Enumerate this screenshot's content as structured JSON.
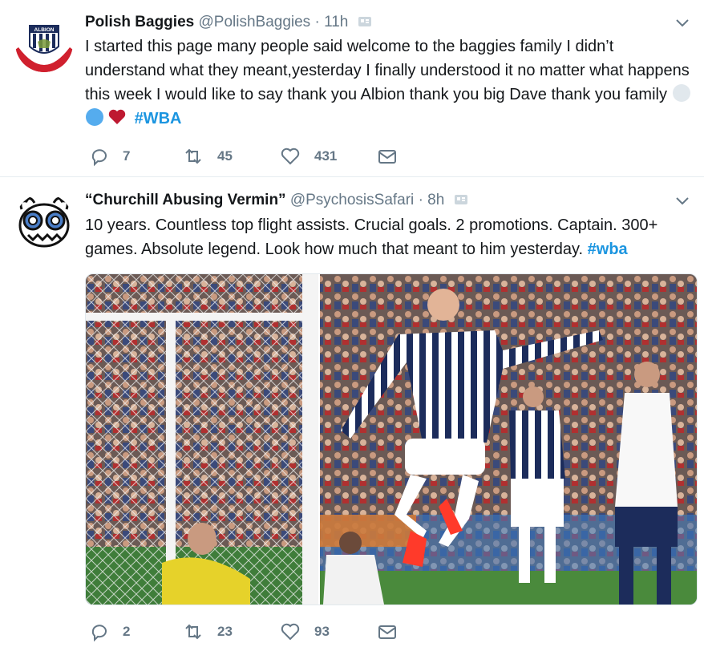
{
  "tweets": [
    {
      "display_name": "Polish Baggies",
      "handle": "@PolishBaggies",
      "separator": "·",
      "time": "11h",
      "avatar_text": "ALBION",
      "text": "I started this page many people said welcome to the baggies family I didn’t understand what they meant,yesterday I finally understood it no matter what happens this week I would like to say thank you Albion thank you big Dave thank you family",
      "hashtag": "#WBA",
      "emojis": [
        "white-circle",
        "blue-circle",
        "red-heart"
      ],
      "replies": "7",
      "retweets": "45",
      "likes": "431"
    },
    {
      "display_name": "“Churchill Abusing Vermin”",
      "handle": "@PsychosisSafari",
      "separator": "·",
      "time": "8h",
      "text": "10 years. Countless top flight assists. Crucial goals. 2 promotions. Captain. 300+ games. Absolute legend. Look how much that meant to him yesterday.",
      "hashtag": "#wba",
      "replies": "2",
      "retweets": "23",
      "likes": "93"
    }
  ],
  "colors": {
    "link": "#1b95e0",
    "muted": "#657786",
    "text": "#14171a",
    "divider": "#e6ecf0"
  }
}
